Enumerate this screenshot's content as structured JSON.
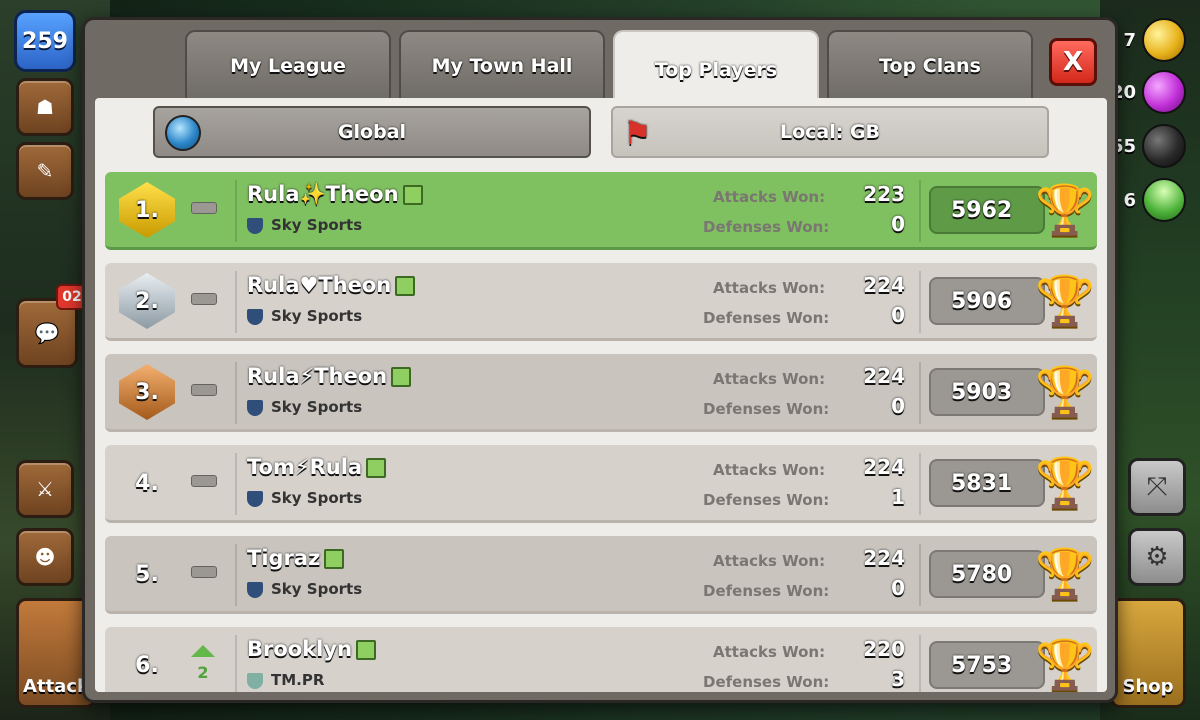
{
  "hud": {
    "xp_level": "259",
    "chat_badge": "02",
    "attack_label": "Attack",
    "shop_label": "Shop",
    "resources": [
      {
        "name": "gold",
        "value": "7"
      },
      {
        "name": "elixir",
        "value": "20"
      },
      {
        "name": "dark-elixir",
        "value": "55"
      },
      {
        "name": "gems",
        "value": "6"
      }
    ]
  },
  "tabs": [
    {
      "label": "My League",
      "active": false
    },
    {
      "label": "My Town Hall",
      "active": false
    },
    {
      "label": "Top Players",
      "active": true
    },
    {
      "label": "Top Clans",
      "active": false
    }
  ],
  "close_label": "X",
  "filters": {
    "global": "Global",
    "local": "Local: GB"
  },
  "stat_labels": {
    "attacks": "Attacks Won:",
    "defenses": "Defenses Won:"
  },
  "players": [
    {
      "rank": "1.",
      "name": "Rula✨Theon",
      "clan": "Sky Sports",
      "attacks_won": "223",
      "defenses_won": "0",
      "trophies": "5962",
      "trend": "",
      "highlight": true
    },
    {
      "rank": "2.",
      "name": "Rula♥Theon",
      "clan": "Sky Sports",
      "attacks_won": "224",
      "defenses_won": "0",
      "trophies": "5906",
      "trend": "",
      "highlight": false
    },
    {
      "rank": "3.",
      "name": "Rula⚡Theon",
      "clan": "Sky Sports",
      "attacks_won": "224",
      "defenses_won": "0",
      "trophies": "5903",
      "trend": "",
      "highlight": false
    },
    {
      "rank": "4.",
      "name": "Tom⚡Rula",
      "clan": "Sky Sports",
      "attacks_won": "224",
      "defenses_won": "1",
      "trophies": "5831",
      "trend": "",
      "highlight": false
    },
    {
      "rank": "5.",
      "name": "Tigraz",
      "clan": "Sky Sports",
      "attacks_won": "224",
      "defenses_won": "0",
      "trophies": "5780",
      "trend": "",
      "highlight": false
    },
    {
      "rank": "6.",
      "name": "Brooklyn",
      "clan": "TM.PR",
      "attacks_won": "220",
      "defenses_won": "3",
      "trophies": "5753",
      "trend": "2",
      "highlight": false
    }
  ]
}
